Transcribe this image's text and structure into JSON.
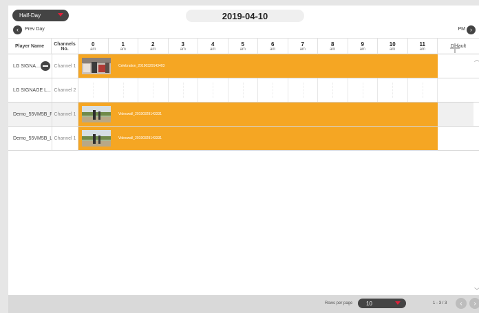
{
  "header": {
    "mode_select": "Half-Day",
    "date": "2019-04-10",
    "prev_label": "Prev Day",
    "period_label": "PM"
  },
  "columns": {
    "player": "Player Name",
    "channel_line1": "Channels",
    "channel_line2": "No.",
    "default": "Default",
    "hours": [
      {
        "num": "0",
        "ampm": "am"
      },
      {
        "num": "1",
        "ampm": "am"
      },
      {
        "num": "2",
        "ampm": "am"
      },
      {
        "num": "3",
        "ampm": "am"
      },
      {
        "num": "4",
        "ampm": "am"
      },
      {
        "num": "5",
        "ampm": "am"
      },
      {
        "num": "6",
        "ampm": "am"
      },
      {
        "num": "7",
        "ampm": "am"
      },
      {
        "num": "8",
        "ampm": "am"
      },
      {
        "num": "9",
        "ampm": "am"
      },
      {
        "num": "10",
        "ampm": "am"
      },
      {
        "num": "11",
        "ampm": "am"
      }
    ]
  },
  "rows": [
    {
      "player": "LG SIGNA...",
      "channel": "Channel 1",
      "schedule": "Celebration_20190329143403"
    },
    {
      "player": "LG SIGNAGE L...",
      "channel": "Channel 2",
      "schedule": ""
    },
    {
      "player": "Demo_55VM5B_R",
      "channel": "Channel 1",
      "schedule": "Videowall_20190329143331"
    },
    {
      "player": "Demo_55VM5B_L",
      "channel": "Channel 1",
      "schedule": "Videowall_20190329143331"
    }
  ],
  "footer": {
    "rows_per_page_label": "Rows per page",
    "rows_per_page_value": "10",
    "page_info": "1 - 3 / 3"
  },
  "colors": {
    "bar": "#f5a623",
    "accent_arrow": "#e0203a",
    "dark_button": "#444444"
  }
}
